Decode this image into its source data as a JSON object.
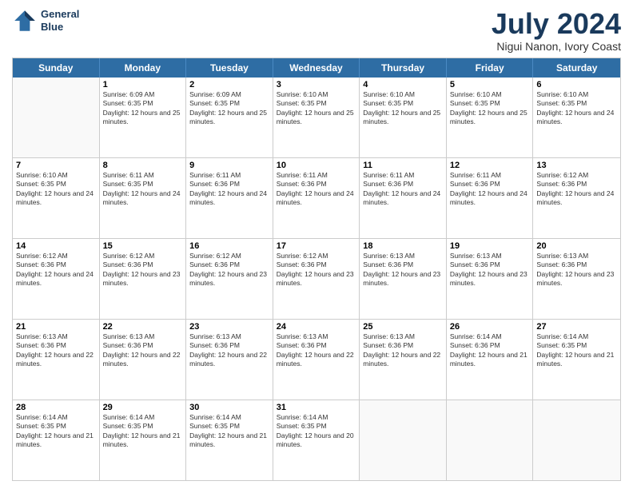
{
  "header": {
    "logo_line1": "General",
    "logo_line2": "Blue",
    "month": "July 2024",
    "location": "Nigui Nanon, Ivory Coast"
  },
  "days_of_week": [
    "Sunday",
    "Monday",
    "Tuesday",
    "Wednesday",
    "Thursday",
    "Friday",
    "Saturday"
  ],
  "weeks": [
    [
      {
        "day": "",
        "sunrise": "",
        "sunset": "",
        "daylight": ""
      },
      {
        "day": "1",
        "sunrise": "Sunrise: 6:09 AM",
        "sunset": "Sunset: 6:35 PM",
        "daylight": "Daylight: 12 hours and 25 minutes."
      },
      {
        "day": "2",
        "sunrise": "Sunrise: 6:09 AM",
        "sunset": "Sunset: 6:35 PM",
        "daylight": "Daylight: 12 hours and 25 minutes."
      },
      {
        "day": "3",
        "sunrise": "Sunrise: 6:10 AM",
        "sunset": "Sunset: 6:35 PM",
        "daylight": "Daylight: 12 hours and 25 minutes."
      },
      {
        "day": "4",
        "sunrise": "Sunrise: 6:10 AM",
        "sunset": "Sunset: 6:35 PM",
        "daylight": "Daylight: 12 hours and 25 minutes."
      },
      {
        "day": "5",
        "sunrise": "Sunrise: 6:10 AM",
        "sunset": "Sunset: 6:35 PM",
        "daylight": "Daylight: 12 hours and 25 minutes."
      },
      {
        "day": "6",
        "sunrise": "Sunrise: 6:10 AM",
        "sunset": "Sunset: 6:35 PM",
        "daylight": "Daylight: 12 hours and 24 minutes."
      }
    ],
    [
      {
        "day": "7",
        "sunrise": "Sunrise: 6:10 AM",
        "sunset": "Sunset: 6:35 PM",
        "daylight": "Daylight: 12 hours and 24 minutes."
      },
      {
        "day": "8",
        "sunrise": "Sunrise: 6:11 AM",
        "sunset": "Sunset: 6:35 PM",
        "daylight": "Daylight: 12 hours and 24 minutes."
      },
      {
        "day": "9",
        "sunrise": "Sunrise: 6:11 AM",
        "sunset": "Sunset: 6:36 PM",
        "daylight": "Daylight: 12 hours and 24 minutes."
      },
      {
        "day": "10",
        "sunrise": "Sunrise: 6:11 AM",
        "sunset": "Sunset: 6:36 PM",
        "daylight": "Daylight: 12 hours and 24 minutes."
      },
      {
        "day": "11",
        "sunrise": "Sunrise: 6:11 AM",
        "sunset": "Sunset: 6:36 PM",
        "daylight": "Daylight: 12 hours and 24 minutes."
      },
      {
        "day": "12",
        "sunrise": "Sunrise: 6:11 AM",
        "sunset": "Sunset: 6:36 PM",
        "daylight": "Daylight: 12 hours and 24 minutes."
      },
      {
        "day": "13",
        "sunrise": "Sunrise: 6:12 AM",
        "sunset": "Sunset: 6:36 PM",
        "daylight": "Daylight: 12 hours and 24 minutes."
      }
    ],
    [
      {
        "day": "14",
        "sunrise": "Sunrise: 6:12 AM",
        "sunset": "Sunset: 6:36 PM",
        "daylight": "Daylight: 12 hours and 24 minutes."
      },
      {
        "day": "15",
        "sunrise": "Sunrise: 6:12 AM",
        "sunset": "Sunset: 6:36 PM",
        "daylight": "Daylight: 12 hours and 23 minutes."
      },
      {
        "day": "16",
        "sunrise": "Sunrise: 6:12 AM",
        "sunset": "Sunset: 6:36 PM",
        "daylight": "Daylight: 12 hours and 23 minutes."
      },
      {
        "day": "17",
        "sunrise": "Sunrise: 6:12 AM",
        "sunset": "Sunset: 6:36 PM",
        "daylight": "Daylight: 12 hours and 23 minutes."
      },
      {
        "day": "18",
        "sunrise": "Sunrise: 6:13 AM",
        "sunset": "Sunset: 6:36 PM",
        "daylight": "Daylight: 12 hours and 23 minutes."
      },
      {
        "day": "19",
        "sunrise": "Sunrise: 6:13 AM",
        "sunset": "Sunset: 6:36 PM",
        "daylight": "Daylight: 12 hours and 23 minutes."
      },
      {
        "day": "20",
        "sunrise": "Sunrise: 6:13 AM",
        "sunset": "Sunset: 6:36 PM",
        "daylight": "Daylight: 12 hours and 23 minutes."
      }
    ],
    [
      {
        "day": "21",
        "sunrise": "Sunrise: 6:13 AM",
        "sunset": "Sunset: 6:36 PM",
        "daylight": "Daylight: 12 hours and 22 minutes."
      },
      {
        "day": "22",
        "sunrise": "Sunrise: 6:13 AM",
        "sunset": "Sunset: 6:36 PM",
        "daylight": "Daylight: 12 hours and 22 minutes."
      },
      {
        "day": "23",
        "sunrise": "Sunrise: 6:13 AM",
        "sunset": "Sunset: 6:36 PM",
        "daylight": "Daylight: 12 hours and 22 minutes."
      },
      {
        "day": "24",
        "sunrise": "Sunrise: 6:13 AM",
        "sunset": "Sunset: 6:36 PM",
        "daylight": "Daylight: 12 hours and 22 minutes."
      },
      {
        "day": "25",
        "sunrise": "Sunrise: 6:13 AM",
        "sunset": "Sunset: 6:36 PM",
        "daylight": "Daylight: 12 hours and 22 minutes."
      },
      {
        "day": "26",
        "sunrise": "Sunrise: 6:14 AM",
        "sunset": "Sunset: 6:36 PM",
        "daylight": "Daylight: 12 hours and 21 minutes."
      },
      {
        "day": "27",
        "sunrise": "Sunrise: 6:14 AM",
        "sunset": "Sunset: 6:35 PM",
        "daylight": "Daylight: 12 hours and 21 minutes."
      }
    ],
    [
      {
        "day": "28",
        "sunrise": "Sunrise: 6:14 AM",
        "sunset": "Sunset: 6:35 PM",
        "daylight": "Daylight: 12 hours and 21 minutes."
      },
      {
        "day": "29",
        "sunrise": "Sunrise: 6:14 AM",
        "sunset": "Sunset: 6:35 PM",
        "daylight": "Daylight: 12 hours and 21 minutes."
      },
      {
        "day": "30",
        "sunrise": "Sunrise: 6:14 AM",
        "sunset": "Sunset: 6:35 PM",
        "daylight": "Daylight: 12 hours and 21 minutes."
      },
      {
        "day": "31",
        "sunrise": "Sunrise: 6:14 AM",
        "sunset": "Sunset: 6:35 PM",
        "daylight": "Daylight: 12 hours and 20 minutes."
      },
      {
        "day": "",
        "sunrise": "",
        "sunset": "",
        "daylight": ""
      },
      {
        "day": "",
        "sunrise": "",
        "sunset": "",
        "daylight": ""
      },
      {
        "day": "",
        "sunrise": "",
        "sunset": "",
        "daylight": ""
      }
    ]
  ]
}
